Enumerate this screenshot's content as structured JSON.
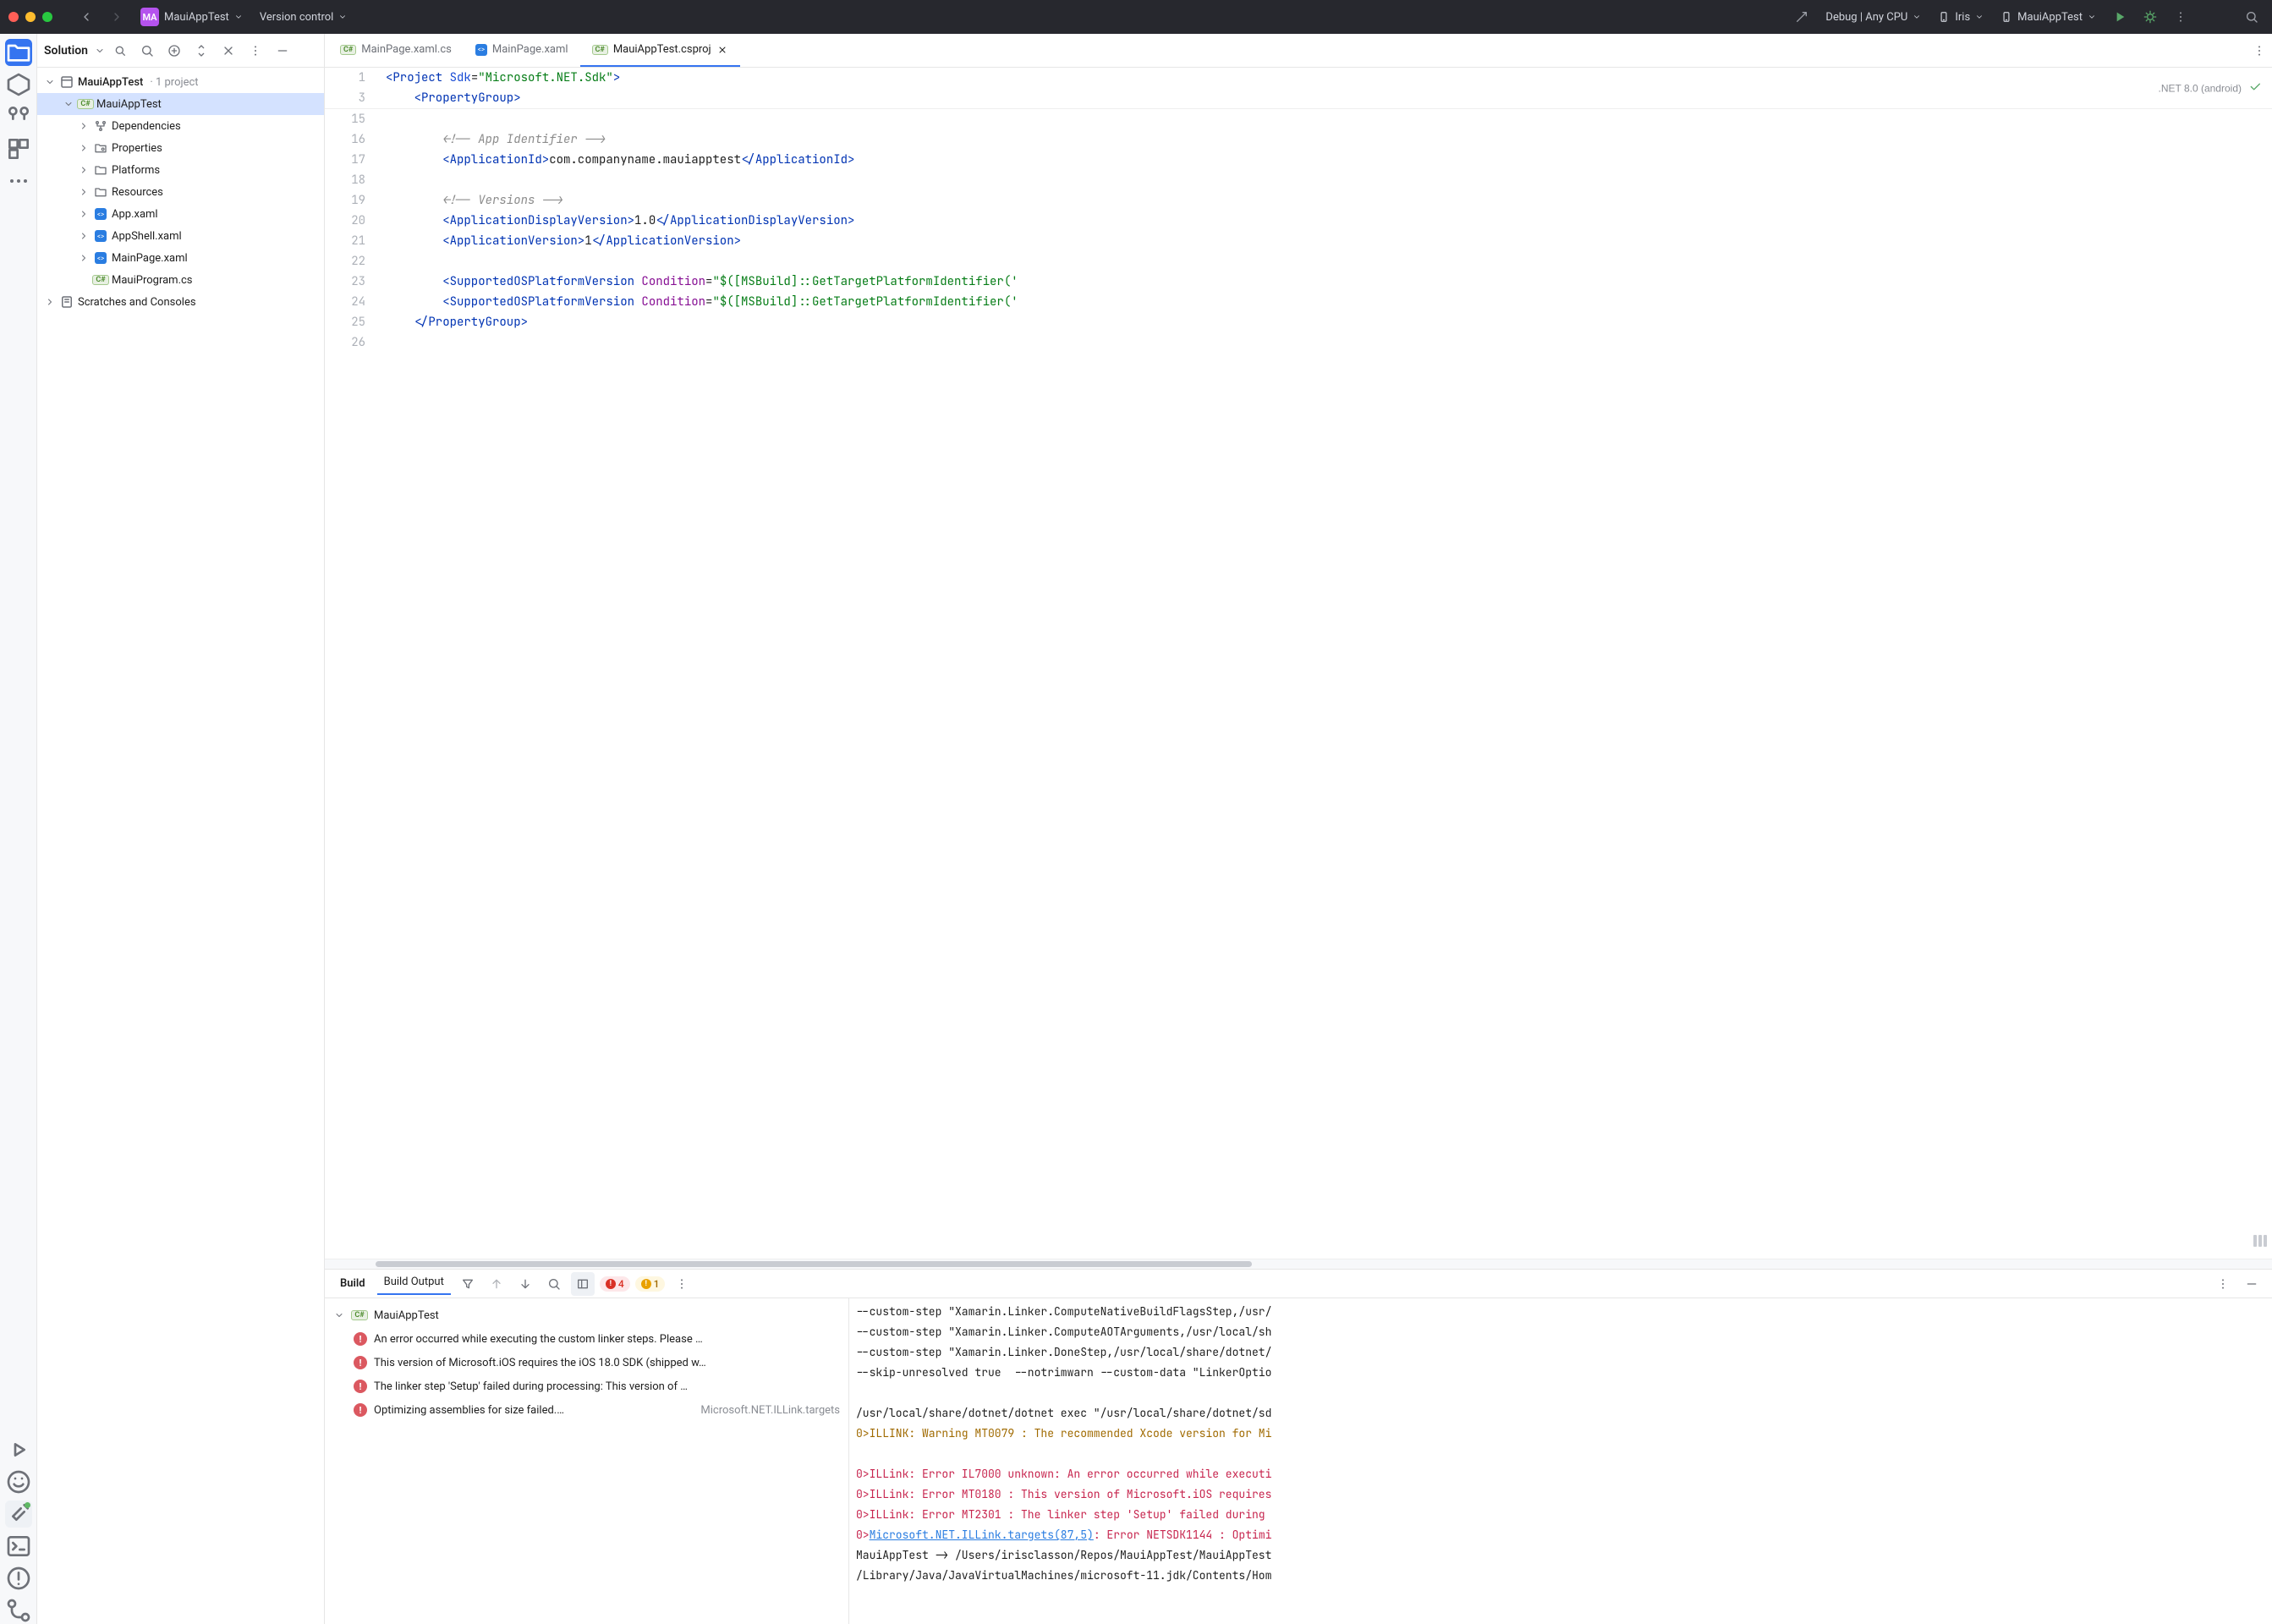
{
  "titlebar": {
    "app_name": "MauiAppTest",
    "app_badge": "MA",
    "vcs_label": "Version control",
    "config_label": "Debug | Any CPU",
    "device_label": "Iris",
    "target_label": "MauiAppTest"
  },
  "solution": {
    "title": "Solution",
    "root": {
      "label": "MauiAppTest",
      "sub": "· 1 project"
    },
    "project": {
      "label": "MauiAppTest"
    },
    "children": [
      {
        "label": "Dependencies",
        "icon": "deps"
      },
      {
        "label": "Properties",
        "icon": "folder-cfg"
      },
      {
        "label": "Platforms",
        "icon": "folder"
      },
      {
        "label": "Resources",
        "icon": "folder"
      },
      {
        "label": "App.xaml",
        "icon": "xaml"
      },
      {
        "label": "AppShell.xaml",
        "icon": "xaml"
      },
      {
        "label": "MainPage.xaml",
        "icon": "xaml"
      },
      {
        "label": "MauiProgram.cs",
        "icon": "cs"
      }
    ],
    "scratches": "Scratches and Consoles"
  },
  "tabs": [
    {
      "label": "MainPage.xaml.cs",
      "icon": "cs",
      "active": false
    },
    {
      "label": "MainPage.xaml",
      "icon": "xaml",
      "active": false
    },
    {
      "label": "MauiAppTest.csproj",
      "icon": "cs",
      "active": true
    }
  ],
  "editor": {
    "sdk_badge": ".NET 8.0 (android)",
    "top_gutter": [
      "1",
      "3"
    ],
    "top_lines_html": [
      "<span class='tok-tag'>&lt;Project</span> <span class='tok-attr'>Sdk</span>=<span class='tok-str'>\"Microsoft.NET.Sdk\"</span><span class='tok-tag'>&gt;</span>",
      "    <span class='tok-tag'>&lt;PropertyGroup&gt;</span>"
    ],
    "body_gutter": [
      "15",
      "16",
      "17",
      "18",
      "19",
      "20",
      "21",
      "22",
      "23",
      "24",
      "25",
      "26"
    ],
    "body_lines_html": [
      "",
      "        <span class='tok-cmt'>&lt;!-- App Identifier --&gt;</span>",
      "        <span class='tok-tag'>&lt;ApplicationId&gt;</span>com.companyname.mauiapptest<span class='tok-tag'>&lt;/ApplicationId&gt;</span>",
      "",
      "        <span class='tok-cmt'>&lt;!-- Versions --&gt;</span>",
      "        <span class='tok-tag'>&lt;ApplicationDisplayVersion&gt;</span>1.0<span class='tok-tag'>&lt;/ApplicationDisplayVersion&gt;</span>",
      "        <span class='tok-tag'>&lt;ApplicationVersion&gt;</span>1<span class='tok-tag'>&lt;/ApplicationVersion&gt;</span>",
      "",
      "        <span class='tok-tag'>&lt;SupportedOSPlatformVersion</span> <span class='tok-cond'>Condition</span>=<span class='tok-str'>\"$([MSBuild]::GetTargetPlatformIdentifier('</span>",
      "        <span class='tok-tag'>&lt;SupportedOSPlatformVersion</span> <span class='tok-cond'>Condition</span>=<span class='tok-str'>\"$([MSBuild]::GetTargetPlatformIdentifier('</span>",
      "    <span class='tok-tag'>&lt;/PropertyGroup&gt;</span>",
      ""
    ]
  },
  "build": {
    "tab_build": "Build",
    "tab_output": "Build Output",
    "err_count": "4",
    "warn_count": "1",
    "tree_root": "MauiAppTest",
    "errors": [
      {
        "msg": "An error occurred while executing the custom linker steps. Please …",
        "origin": ""
      },
      {
        "msg": "This version of Microsoft.iOS requires the iOS 18.0 SDK (shipped w…",
        "origin": ""
      },
      {
        "msg": "The linker step 'Setup' failed during processing: This version of …",
        "origin": ""
      },
      {
        "msg": "Optimizing assemblies for size failed.…",
        "origin": "Microsoft.NET.ILLink.targets"
      }
    ],
    "output_lines": [
      {
        "cls": "",
        "text": "--custom-step \"Xamarin.Linker.ComputeNativeBuildFlagsStep,/usr/"
      },
      {
        "cls": "",
        "text": "--custom-step \"Xamarin.Linker.ComputeAOTArguments,/usr/local/sh"
      },
      {
        "cls": "",
        "text": "--custom-step \"Xamarin.Linker.DoneStep,/usr/local/share/dotnet/"
      },
      {
        "cls": "",
        "text": "--skip-unresolved true  --notrimwarn --custom-data \"LinkerOptio"
      },
      {
        "cls": "",
        "text": ""
      },
      {
        "cls": "",
        "text": "/usr/local/share/dotnet/dotnet exec \"/usr/local/share/dotnet/sd"
      },
      {
        "cls": "bo-warn",
        "text": "0>ILLINK: Warning MT0079 : The recommended Xcode version for Mi"
      },
      {
        "cls": "",
        "text": ""
      },
      {
        "cls": "bo-err",
        "text": "0>ILLink: Error IL7000 unknown: An error occurred while executi"
      },
      {
        "cls": "bo-err",
        "text": "0>ILLink: Error MT0180 : This version of Microsoft.iOS requires"
      },
      {
        "cls": "bo-err",
        "text": "0>ILLink: Error MT2301 : The linker step 'Setup' failed during "
      },
      {
        "cls": "bo-err",
        "text": "0><span class='bo-link'>Microsoft.NET.ILLink.targets(87,5)</span>: Error NETSDK1144 : Optimi"
      },
      {
        "cls": "",
        "text": "MauiAppTest -> /Users/irisclasson/Repos/MauiAppTest/MauiAppTest"
      },
      {
        "cls": "",
        "text": "/Library/Java/JavaVirtualMachines/microsoft-11.jdk/Contents/Hom"
      }
    ]
  }
}
